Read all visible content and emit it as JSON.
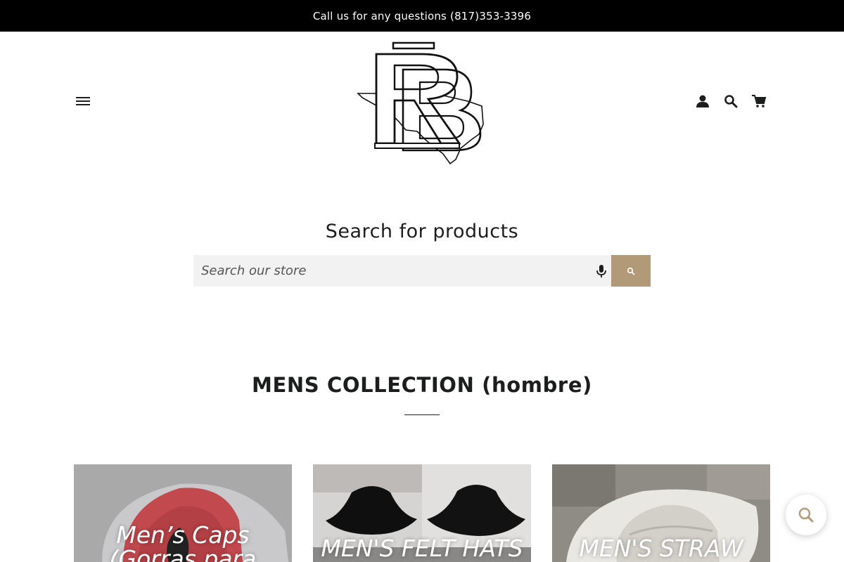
{
  "announcement": {
    "text": "Call us for any questions (817)353-3396"
  },
  "header": {
    "menu_icon": "hamburger-icon",
    "logo_alt": "RB logo",
    "icons": [
      "user-icon",
      "search-icon",
      "cart-icon"
    ]
  },
  "search": {
    "title": "Search for products",
    "placeholder": "Search our store",
    "mic_icon": "microphone-icon",
    "submit_icon": "search-icon",
    "accent_color": "#b29a79"
  },
  "collection": {
    "title": "MENS COLLECTION (hombre)",
    "cards": [
      {
        "label_line1": "Men’s Caps",
        "label_line2": "(Gorras para"
      },
      {
        "label_line1": "MEN'S FELT HATS"
      },
      {
        "label_line1": "MEN'S STRAW"
      }
    ]
  },
  "fab": {
    "icon": "search-icon"
  }
}
